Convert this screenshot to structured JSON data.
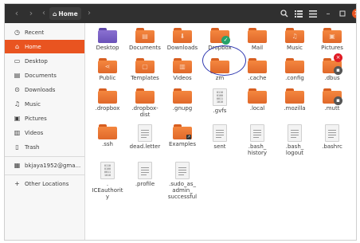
{
  "titlebar": {
    "location": "Home"
  },
  "sidebar": {
    "items": [
      {
        "label": "Recent",
        "icon": "clock-icon"
      },
      {
        "label": "Home",
        "icon": "home-icon"
      },
      {
        "label": "Desktop",
        "icon": "desktop-icon"
      },
      {
        "label": "Documents",
        "icon": "documents-icon"
      },
      {
        "label": "Downloads",
        "icon": "download-icon"
      },
      {
        "label": "Music",
        "icon": "music-icon"
      },
      {
        "label": "Pictures",
        "icon": "camera-icon"
      },
      {
        "label": "Videos",
        "icon": "film-icon"
      },
      {
        "label": "Trash",
        "icon": "trash-icon"
      },
      {
        "label": "bkjaya1952@gma...",
        "icon": "drive-icon"
      },
      {
        "label": "Other Locations",
        "icon": "plus-icon"
      }
    ]
  },
  "files": [
    {
      "name": "Desktop"
    },
    {
      "name": "Documents"
    },
    {
      "name": "Downloads"
    },
    {
      "name": "Dropbox"
    },
    {
      "name": "Mail"
    },
    {
      "name": "Music"
    },
    {
      "name": "Pictures"
    },
    {
      "name": "Public"
    },
    {
      "name": "Templates"
    },
    {
      "name": "Videos"
    },
    {
      "name": "zm"
    },
    {
      "name": ".cache"
    },
    {
      "name": ".config"
    },
    {
      "name": ".dbus"
    },
    {
      "name": ".dropbox"
    },
    {
      "name": ".dropbox-\ndist"
    },
    {
      "name": ".gnupg"
    },
    {
      "name": ".gvfs"
    },
    {
      "name": ".local"
    },
    {
      "name": ".mozilla"
    },
    {
      "name": ".mutt"
    },
    {
      "name": ".ssh"
    },
    {
      "name": "dead.letter"
    },
    {
      "name": "Examples"
    },
    {
      "name": "sent"
    },
    {
      "name": ".bash_\nhistory"
    },
    {
      "name": ".bash_\nlogout"
    },
    {
      "name": ".bashrc"
    },
    {
      "name": ".\nICEauthorit\ny"
    },
    {
      "name": ".profile"
    },
    {
      "name": ".sudo_as_\nadmin_\nsuccessful"
    }
  ],
  "binary_text": "0110\n0100\n0011\n1010",
  "colors": {
    "accent": "#e95420",
    "folder": "#f07a33",
    "titlebar": "#303030",
    "annotation": "#2f38b0"
  }
}
